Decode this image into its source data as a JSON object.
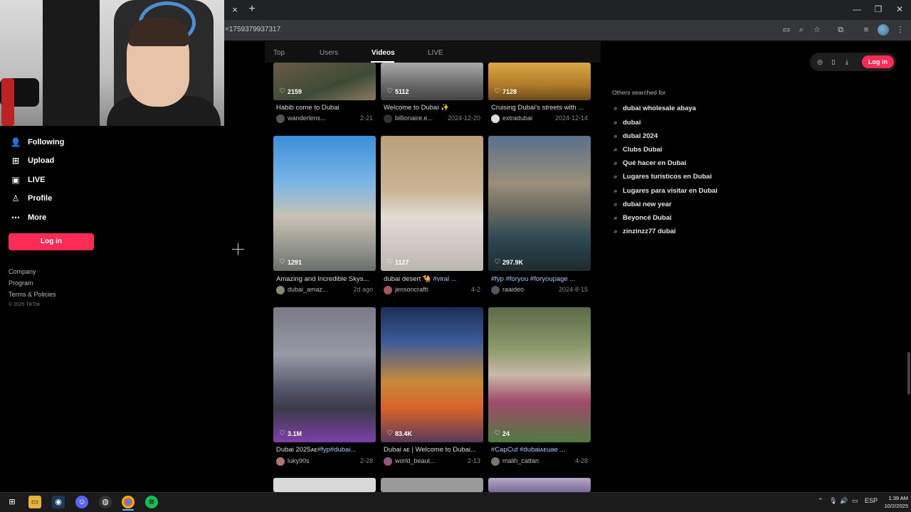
{
  "browser": {
    "url_fragment": "=1759379937317",
    "tab_close": "×",
    "tab_new": "+",
    "window_controls": [
      "—",
      "❐",
      "✕"
    ]
  },
  "sidebar": {
    "items": [
      {
        "label": "Following",
        "icon": "following-icon"
      },
      {
        "label": "Upload",
        "icon": "upload-icon"
      },
      {
        "label": "LIVE",
        "icon": "live-icon"
      },
      {
        "label": "Profile",
        "icon": "profile-icon"
      },
      {
        "label": "More",
        "icon": "more-icon"
      }
    ],
    "login_label": "Log in",
    "footer": [
      "Company",
      "Program",
      "Terms & Policies"
    ],
    "copyright": "© 2025 TikTok"
  },
  "search_tabs": [
    "Top",
    "Users",
    "Videos",
    "LIVE"
  ],
  "active_tab": "Videos",
  "header_right": {
    "login_label": "Log in"
  },
  "videos": [
    {
      "likes": "2159",
      "caption": "Habib come to Dubai",
      "user": "wanderlens...",
      "date": "2-21"
    },
    {
      "likes": "5112",
      "caption": "Welcome to Dubai ✨",
      "user": "billionaire.e...",
      "date": "2024-12-20"
    },
    {
      "likes": "7128",
      "caption": "Cruising Dubai's streets with ...",
      "user": "extradubai",
      "date": "2024-12-14"
    },
    {
      "likes": "1291",
      "caption": "Amazing and Incredible Skys...",
      "user": "dubai_amaz...",
      "date": "2d ago"
    },
    {
      "likes": "1127",
      "caption": "dubai desert 🐪 ",
      "caption_tag": "#viral ...",
      "user": "jensoncraftt",
      "date": "4-2"
    },
    {
      "likes": "297.9K",
      "caption": "",
      "caption_tag": "#fyp #foryou #foryoupage ...",
      "user": "raaideo",
      "date": "2024-8-15"
    },
    {
      "likes": "3.1M",
      "caption": "Dubai 2025ᴀᴇ",
      "caption_tag": "#fyp#dubai...",
      "user": "luky90s",
      "date": "2-28"
    },
    {
      "likes": "83.4K",
      "caption": "Dubai ᴀᴇ | Welcome to Dubai...",
      "user": "world_beaut...",
      "date": "2-13"
    },
    {
      "likes": "24",
      "caption": "",
      "caption_tag": "#CapCut #dubaiᴀᴇuae ...",
      "user": "malih_cattan",
      "date": "4-28"
    }
  ],
  "others_searched": {
    "title": "Others searched for",
    "items": [
      "dubai wholesale abaya",
      "dubai",
      "dubai 2024",
      "Clubs Dubai",
      "Qué hacer en Dubai",
      "Lugares turísticos en Dubai",
      "Lugares para visitar en Dubai",
      "dubai new year",
      "Beyoncé Dubai",
      "zinzinzz77 dubai"
    ]
  },
  "taskbar": {
    "language": "ESP",
    "time": "1:39 AM",
    "date": "10/2/2025"
  },
  "colors": {
    "brand": "#fe2c55",
    "background": "#000000"
  }
}
